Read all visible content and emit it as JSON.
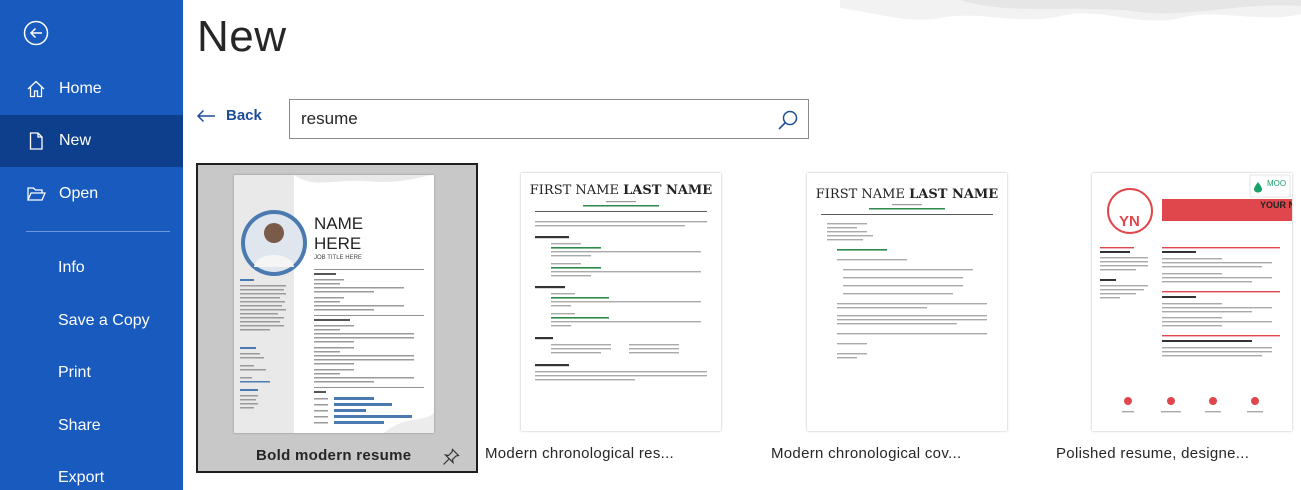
{
  "sidebar": {
    "items": [
      {
        "label": "Home",
        "icon": "home-icon"
      },
      {
        "label": "New",
        "icon": "new-document-icon",
        "active": true
      },
      {
        "label": "Open",
        "icon": "folder-open-icon"
      },
      {
        "label": "Info"
      },
      {
        "label": "Save a Copy"
      },
      {
        "label": "Print"
      },
      {
        "label": "Share"
      },
      {
        "label": "Export"
      }
    ]
  },
  "main": {
    "title": "New",
    "back_label": "Back",
    "search": {
      "value": "resume"
    }
  },
  "templates": [
    {
      "label": "Bold modern resume",
      "selected": true,
      "preview": {
        "name_line1": "NAME",
        "name_line2": "HERE",
        "subtitle": "JOB TITLE HERE"
      }
    },
    {
      "label": "Modern chronological res...",
      "preview": {
        "name_first": "FIRST NAME ",
        "name_last": "LAST NAME"
      }
    },
    {
      "label": "Modern chronological cov...",
      "preview": {
        "name_first": "FIRST NAME ",
        "name_last": "LAST NAME"
      }
    },
    {
      "label": "Polished resume, designe...",
      "preview": {
        "initials": "YN",
        "badge": "MOO",
        "name_fragment": "YOUR N"
      }
    }
  ],
  "colors": {
    "sidebar": "#185abd",
    "sidebar_active": "#0e3f8c",
    "link": "#1f4e99",
    "accent_red": "#e0474c"
  }
}
